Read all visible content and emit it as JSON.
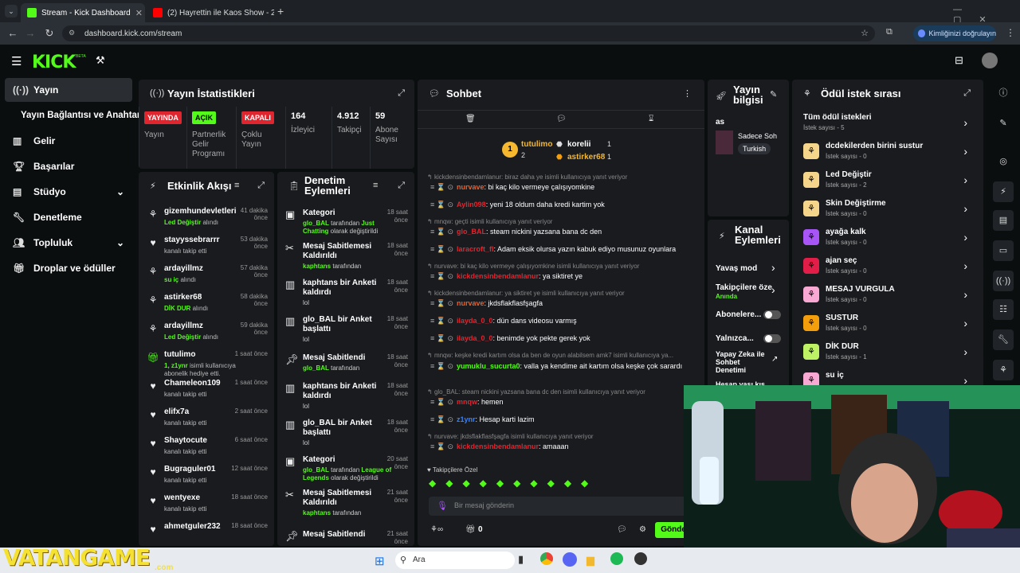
{
  "browser": {
    "tabs": [
      {
        "title": "Stream - Kick Dashboard",
        "active": true
      },
      {
        "title": "(2) Hayrettin ile Kaos Show - 2...",
        "active": false
      }
    ],
    "url": "dashboard.kick.com/stream",
    "identity_button": "Kimliğinizi doğrulayın"
  },
  "header": {
    "logo": "KICK",
    "logo_sup": "BETA"
  },
  "sidebar": {
    "items": [
      {
        "label": "Yayın",
        "icon": "broadcast-icon",
        "active": true
      },
      {
        "label": "Yayın Bağlantısı ve Anahtarı",
        "icon": "",
        "active": false
      },
      {
        "label": "Gelir",
        "icon": "revenue-icon",
        "active": false
      },
      {
        "label": "Başarılar",
        "icon": "trophy-icon",
        "active": false
      },
      {
        "label": "Stüdyo",
        "icon": "studio-icon",
        "active": false
      },
      {
        "label": "Denetleme",
        "icon": "wrench-icon",
        "active": false
      },
      {
        "label": "Topluluk",
        "icon": "community-icon",
        "active": false
      },
      {
        "label": "Droplar ve ödüller",
        "icon": "gift-icon",
        "active": false
      }
    ]
  },
  "stats": {
    "title": "Yayın İstatistikleri",
    "cells": [
      {
        "value": "YAYINDA",
        "label": "Yayın",
        "color": "#e1252f",
        "type": "badge"
      },
      {
        "value": "AÇIK",
        "label": "Partnerlik Gelir Programı",
        "color": "#53fc18",
        "type": "badge"
      },
      {
        "value": "KAPALI",
        "label": "Çoklu Yayın",
        "color": "#e1252f",
        "type": "badge"
      },
      {
        "value": "164",
        "label": "İzleyici",
        "type": "num"
      },
      {
        "value": "4.912",
        "label": "Takipçi",
        "type": "num"
      },
      {
        "value": "59",
        "label": "Abone Sayısı",
        "type": "num"
      }
    ]
  },
  "activity": {
    "title": "Etkinlik Akışı",
    "rows": [
      {
        "name": "gizemhundevletleri",
        "sub_pre": "",
        "sub_b": "Led Değiştir",
        "sub_post": " alındı",
        "time": "41 dakika önce",
        "icon": "reward-icon"
      },
      {
        "name": "stayyssebrarrr",
        "sub_pre": "kanalı takip etti",
        "sub_b": "",
        "sub_post": "",
        "time": "53 dakika önce",
        "icon": "heart-icon"
      },
      {
        "name": "ardayillmz",
        "sub_pre": "",
        "sub_b": "su iç",
        "sub_post": " alındı",
        "time": "57 dakika önce",
        "icon": "reward-icon"
      },
      {
        "name": "astirker68",
        "sub_pre": "",
        "sub_b": "DİK DUR",
        "sub_post": " alındı",
        "time": "58 dakika önce",
        "icon": "reward-icon"
      },
      {
        "name": "ardayillmz",
        "sub_pre": "",
        "sub_b": "Led Değiştir",
        "sub_post": " alındı",
        "time": "59 dakika önce",
        "icon": "reward-icon"
      },
      {
        "name": "tutulimo",
        "sub_pre": "",
        "sub_b": "1, z1ynr",
        "sub_post": " isimli kullanıcıya abonelik hediye etti.",
        "time": "1 saat önce",
        "icon": "gift-icon"
      },
      {
        "name": "Chameleon109",
        "sub_pre": "kanalı takip etti",
        "sub_b": "",
        "sub_post": "",
        "time": "1 saat önce",
        "icon": "heart-icon"
      },
      {
        "name": "elifx7a",
        "sub_pre": "kanalı takip etti",
        "sub_b": "",
        "sub_post": "",
        "time": "2 saat önce",
        "icon": "heart-icon"
      },
      {
        "name": "Shaytocute",
        "sub_pre": "kanalı takip etti",
        "sub_b": "",
        "sub_post": "",
        "time": "6 saat önce",
        "icon": "heart-icon"
      },
      {
        "name": "Bugraguler01",
        "sub_pre": "kanalı takip etti",
        "sub_b": "",
        "sub_post": "",
        "time": "12 saat önce",
        "icon": "heart-icon"
      },
      {
        "name": "wentyexe",
        "sub_pre": "kanalı takip etti",
        "sub_b": "",
        "sub_post": "",
        "time": "18 saat önce",
        "icon": "heart-icon"
      },
      {
        "name": "ahmetguler232",
        "sub_pre": "",
        "sub_b": "",
        "sub_post": "",
        "time": "18 saat önce",
        "icon": "heart-icon"
      }
    ]
  },
  "moderation": {
    "title": "Denetim Eylemleri",
    "rows": [
      {
        "t": "Kategori",
        "s_b": "glo_BAL",
        "s": " tarafından ",
        "s_b2": "Just Chatting",
        "s2": " olarak değiştirildi",
        "time": "18 saat önce",
        "icon": "category-icon"
      },
      {
        "t": "Mesaj Sabitlemesi Kaldırıldı",
        "s_b": "kaphtans",
        "s": " tarafından",
        "s_b2": "",
        "s2": "",
        "time": "18 saat önce",
        "icon": "unpin-icon"
      },
      {
        "t": "kaphtans bir Anketi kaldırdı",
        "s_b": "",
        "s": "lol",
        "s_b2": "",
        "s2": "",
        "time": "18 saat önce",
        "icon": "poll-icon"
      },
      {
        "t": "glo_BAL bir Anket başlattı",
        "s_b": "",
        "s": "lol",
        "s_b2": "",
        "s2": "",
        "time": "18 saat önce",
        "icon": "poll-icon"
      },
      {
        "t": "Mesaj Sabitlendi",
        "s_b": "glo_BAL",
        "s": " tarafından",
        "s_b2": "",
        "s2": "",
        "time": "18 saat önce",
        "icon": "pin-icon"
      },
      {
        "t": "kaphtans bir Anketi kaldırdı",
        "s_b": "",
        "s": "lol",
        "s_b2": "",
        "s2": "",
        "time": "18 saat önce",
        "icon": "poll-icon"
      },
      {
        "t": "glo_BAL bir Anket başlattı",
        "s_b": "",
        "s": "lol",
        "s_b2": "",
        "s2": "",
        "time": "18 saat önce",
        "icon": "poll-icon"
      },
      {
        "t": "Kategori",
        "s_b": "glo_BAL",
        "s": " tarafından ",
        "s_b2": "League of Legends",
        "s2": " olarak değiştirildi",
        "time": "20 saat önce",
        "icon": "category-icon"
      },
      {
        "t": "Mesaj Sabitlemesi Kaldırıldı",
        "s_b": "kaphtans",
        "s": " tarafından",
        "s_b2": "",
        "s2": "",
        "time": "21 saat önce",
        "icon": "unpin-icon"
      },
      {
        "t": "Mesaj Sabitlendi",
        "s_b": "",
        "s": "",
        "s_b2": "",
        "s2": "",
        "time": "21 saat önce",
        "icon": "pin-icon"
      }
    ]
  },
  "chat": {
    "title": "Sohbet",
    "leaderboard": [
      {
        "rank": "1",
        "name": "tutulimo",
        "count": "2"
      },
      {
        "rank": "",
        "name": "korelii",
        "count": "1"
      },
      {
        "rank": "",
        "name": "astirker68",
        "count": "1"
      }
    ],
    "messages": [
      {
        "reply": "kickdensinbendamlanur: biraz daha ye isimli kullanıcıya yanıt veriyor",
        "user": "nurvave",
        "color": "#e8612c",
        "text": ": bi kaç kilo vermeye çalışıyomkine"
      },
      {
        "reply": "",
        "user": "Aylin098",
        "color": "#e1252f",
        "text": ": yeni 18 oldum daha kredi kartim yok"
      },
      {
        "reply": "mnqw: geçti isimli kullanıcıya yanıt veriyor",
        "user": "glo_BAL",
        "color": "#e1252f",
        "text": ": steam nickini yazsana bana dc den"
      },
      {
        "reply": "",
        "user": "laracroft_fl",
        "color": "#e1252f",
        "text": ": Adam eksik olursa yazın kabuk ediyo musunuz oyunlara"
      },
      {
        "reply": "nurvave: bi kaç kilo vermeye çalışıyomkine isimli kullanıcıya yanıt veriyor",
        "user": "kickdensinbendamlanur",
        "color": "#e1252f",
        "text": ": ya siktiret ye"
      },
      {
        "reply": "kickdensinbendamlanur: ya siktiret ye isimli kullanıcıya yanıt veriyor",
        "user": "nurvave",
        "color": "#e8612c",
        "text": ": jkdsflakflasfşagfa"
      },
      {
        "reply": "",
        "user": "ilayda_0_0",
        "color": "#e1252f",
        "text": ": dün dans videosu varmış"
      },
      {
        "reply": "",
        "user": "ilayda_0_0",
        "color": "#e1252f",
        "text": ": benimde yok pekte gerek yok"
      },
      {
        "reply": "mnqw: keşke kredi kartım olsa da ben de oyun alabilsem amk7 isimli kullanıcıya ya...",
        "user": "yumuklu_sucurta0",
        "color": "#53fc18",
        "text": ": valla ya kendime ait kartım olsa keşke çok sarardı"
      },
      {
        "reply": "glo_BAL: steam nickini yazsana bana dc den isimli kullanıcıya yanıt veriyor",
        "user": "mnqw",
        "color": "#e1252f",
        "text": ": hemen"
      },
      {
        "reply": "",
        "user": "z1ynr",
        "color": "#3b82f6",
        "text": ": Hesap karti lazim"
      },
      {
        "reply": "nurvave: jkdsflakflasfşagfa isimli kullanıcıya yanıt veriyor",
        "user": "kickdensinbendamlanur",
        "color": "#e1252f",
        "text": ": amaaan"
      }
    ],
    "emote_section": "Takipçilere Özel",
    "input_placeholder": "Bir mesaj gönderin",
    "counter": "0",
    "send": "Gönder"
  },
  "info": {
    "title": "Yayın bilgisi",
    "stream_title": "as",
    "option": "Sadece Soh",
    "language": "Turkish"
  },
  "channel_actions": {
    "title": "Kanal Eylemleri",
    "slow": "Yavaş mod",
    "followers": "Takipçilere öze",
    "followers_sub": "Anında",
    "subscribers": "Abonelere...",
    "emote": "Yalnızca...",
    "ai": "Yapay Zeka ile Sohbet Denetimi",
    "more": "Hesap yaşı kıs"
  },
  "rewards": {
    "title": "Ödül istek sırası",
    "all": "Tüm ödül istekleri",
    "all_sub": "İstek sayısı - 5",
    "items": [
      {
        "name": "dcdekilerden birini sustur",
        "sub": "İstek sayısı - 0",
        "color": "#f5d58a"
      },
      {
        "name": "Led Değiştir",
        "sub": "İstek sayısı - 2",
        "color": "#f5d58a"
      },
      {
        "name": "Skin Değiştirme",
        "sub": "İstek sayısı - 0",
        "color": "#f5d58a"
      },
      {
        "name": "ayağa kalk",
        "sub": "İstek sayısı - 0",
        "color": "#a855f7"
      },
      {
        "name": "ajan seç",
        "sub": "İstek sayısı - 0",
        "color": "#e11d48"
      },
      {
        "name": "MESAJ VURGULA",
        "sub": "İstek sayısı - 0",
        "color": "#f9a8d4"
      },
      {
        "name": "SUSTUR",
        "sub": "İstek sayısı - 0",
        "color": "#f59e0b"
      },
      {
        "name": "DİK DUR",
        "sub": "İstek sayısı - 1",
        "color": "#bef264"
      },
      {
        "name": "su iç",
        "sub": "",
        "color": "#f9a8d4"
      }
    ]
  },
  "taskbar": {
    "search": "Ara",
    "watermark": "VATANGAME",
    "watermark_sub": ".com"
  }
}
